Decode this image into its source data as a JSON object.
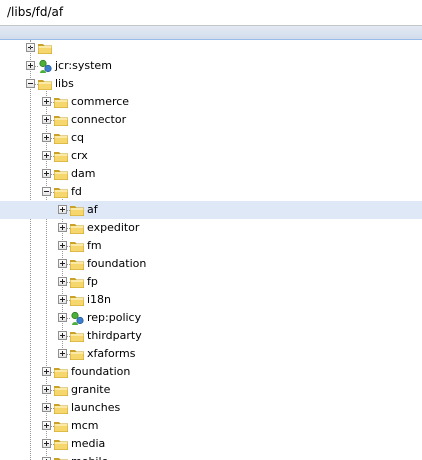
{
  "address_bar": {
    "path": "/libs/fd/af"
  },
  "tree": {
    "nodes": [
      {
        "label": "jcr:system",
        "depth": 1,
        "expanded": false,
        "icon": "special-node-icon"
      },
      {
        "label": "libs",
        "depth": 1,
        "expanded": true,
        "icon": "folder-icon"
      },
      {
        "label": "commerce",
        "depth": 2,
        "expanded": false,
        "icon": "folder-icon"
      },
      {
        "label": "connector",
        "depth": 2,
        "expanded": false,
        "icon": "folder-icon"
      },
      {
        "label": "cq",
        "depth": 2,
        "expanded": false,
        "icon": "folder-icon"
      },
      {
        "label": "crx",
        "depth": 2,
        "expanded": false,
        "icon": "folder-icon"
      },
      {
        "label": "dam",
        "depth": 2,
        "expanded": false,
        "icon": "folder-icon"
      },
      {
        "label": "fd",
        "depth": 2,
        "expanded": true,
        "icon": "folder-icon"
      },
      {
        "label": "af",
        "depth": 3,
        "expanded": false,
        "icon": "folder-icon",
        "selected": true
      },
      {
        "label": "expeditor",
        "depth": 3,
        "expanded": false,
        "icon": "folder-icon"
      },
      {
        "label": "fm",
        "depth": 3,
        "expanded": false,
        "icon": "folder-icon"
      },
      {
        "label": "foundation",
        "depth": 3,
        "expanded": false,
        "icon": "folder-icon"
      },
      {
        "label": "fp",
        "depth": 3,
        "expanded": false,
        "icon": "folder-icon"
      },
      {
        "label": "i18n",
        "depth": 3,
        "expanded": false,
        "icon": "folder-icon"
      },
      {
        "label": "rep:policy",
        "depth": 3,
        "expanded": false,
        "icon": "special-node-icon"
      },
      {
        "label": "thirdparty",
        "depth": 3,
        "expanded": false,
        "icon": "folder-icon"
      },
      {
        "label": "xfaforms",
        "depth": 3,
        "expanded": false,
        "icon": "folder-icon"
      },
      {
        "label": "foundation",
        "depth": 2,
        "expanded": false,
        "icon": "folder-icon"
      },
      {
        "label": "granite",
        "depth": 2,
        "expanded": false,
        "icon": "folder-icon"
      },
      {
        "label": "launches",
        "depth": 2,
        "expanded": false,
        "icon": "folder-icon"
      },
      {
        "label": "mcm",
        "depth": 2,
        "expanded": false,
        "icon": "folder-icon"
      },
      {
        "label": "media",
        "depth": 2,
        "expanded": false,
        "icon": "folder-icon"
      },
      {
        "label": "mobile",
        "depth": 2,
        "expanded": false,
        "icon": "folder-icon"
      }
    ]
  },
  "colors": {
    "selection": "#dfe8f6",
    "header": "#d1dcec",
    "folder": "#f5d76e",
    "folder_border": "#c9a227"
  }
}
